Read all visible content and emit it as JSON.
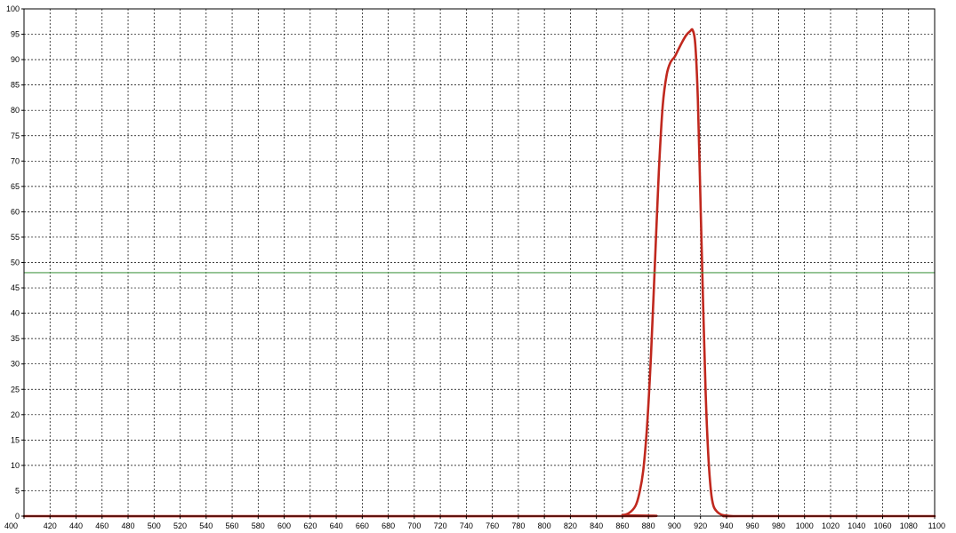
{
  "chart_data": {
    "type": "line",
    "title": "",
    "xlabel": "",
    "ylabel": "",
    "xlim": [
      400,
      1100
    ],
    "ylim": [
      0,
      100
    ],
    "xticks": [
      400,
      420,
      440,
      460,
      480,
      500,
      520,
      540,
      560,
      580,
      600,
      620,
      640,
      660,
      680,
      700,
      720,
      740,
      760,
      780,
      800,
      820,
      840,
      860,
      880,
      900,
      920,
      940,
      960,
      980,
      1000,
      1020,
      1040,
      1060,
      1080,
      1100
    ],
    "yticks": [
      0,
      5,
      10,
      15,
      20,
      25,
      30,
      35,
      40,
      45,
      50,
      55,
      60,
      65,
      70,
      75,
      80,
      85,
      90,
      95,
      100
    ],
    "grid": true,
    "legend": "none",
    "series": [
      {
        "color": "#c0281e",
        "x": [
          400,
          850,
          860,
          865,
          870,
          873,
          876,
          879,
          882,
          885,
          888,
          891,
          894,
          897,
          900,
          903,
          906,
          909,
          912,
          914,
          916,
          918,
          920,
          922,
          924,
          926,
          928,
          930,
          933,
          936,
          940,
          945,
          950,
          1100
        ],
        "y": [
          0,
          0,
          0.2,
          0.6,
          2,
          4.5,
          9,
          18,
          32,
          50,
          68,
          81,
          87,
          89.5,
          90.5,
          92,
          93.5,
          94.8,
          95.6,
          95.8,
          93,
          82,
          62,
          42,
          24,
          12,
          5,
          2,
          0.8,
          0.3,
          0.1,
          0,
          0,
          0
        ]
      },
      {
        "color": "#4a9a4a",
        "x": [
          400,
          1100
        ],
        "y": [
          48,
          48
        ]
      }
    ]
  }
}
